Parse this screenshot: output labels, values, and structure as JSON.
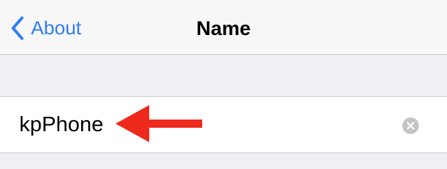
{
  "nav": {
    "back_label": "About",
    "title": "Name"
  },
  "name_field": {
    "value": "kpPhone"
  },
  "icons": {
    "back": "chevron-left-icon",
    "clear": "clear-circle-icon",
    "annotation": "red-arrow-icon"
  },
  "colors": {
    "accent": "#2f7df6",
    "annotation": "#ee2a1c",
    "background": "#efeff4",
    "clear_icon": "#c4c4c7"
  }
}
